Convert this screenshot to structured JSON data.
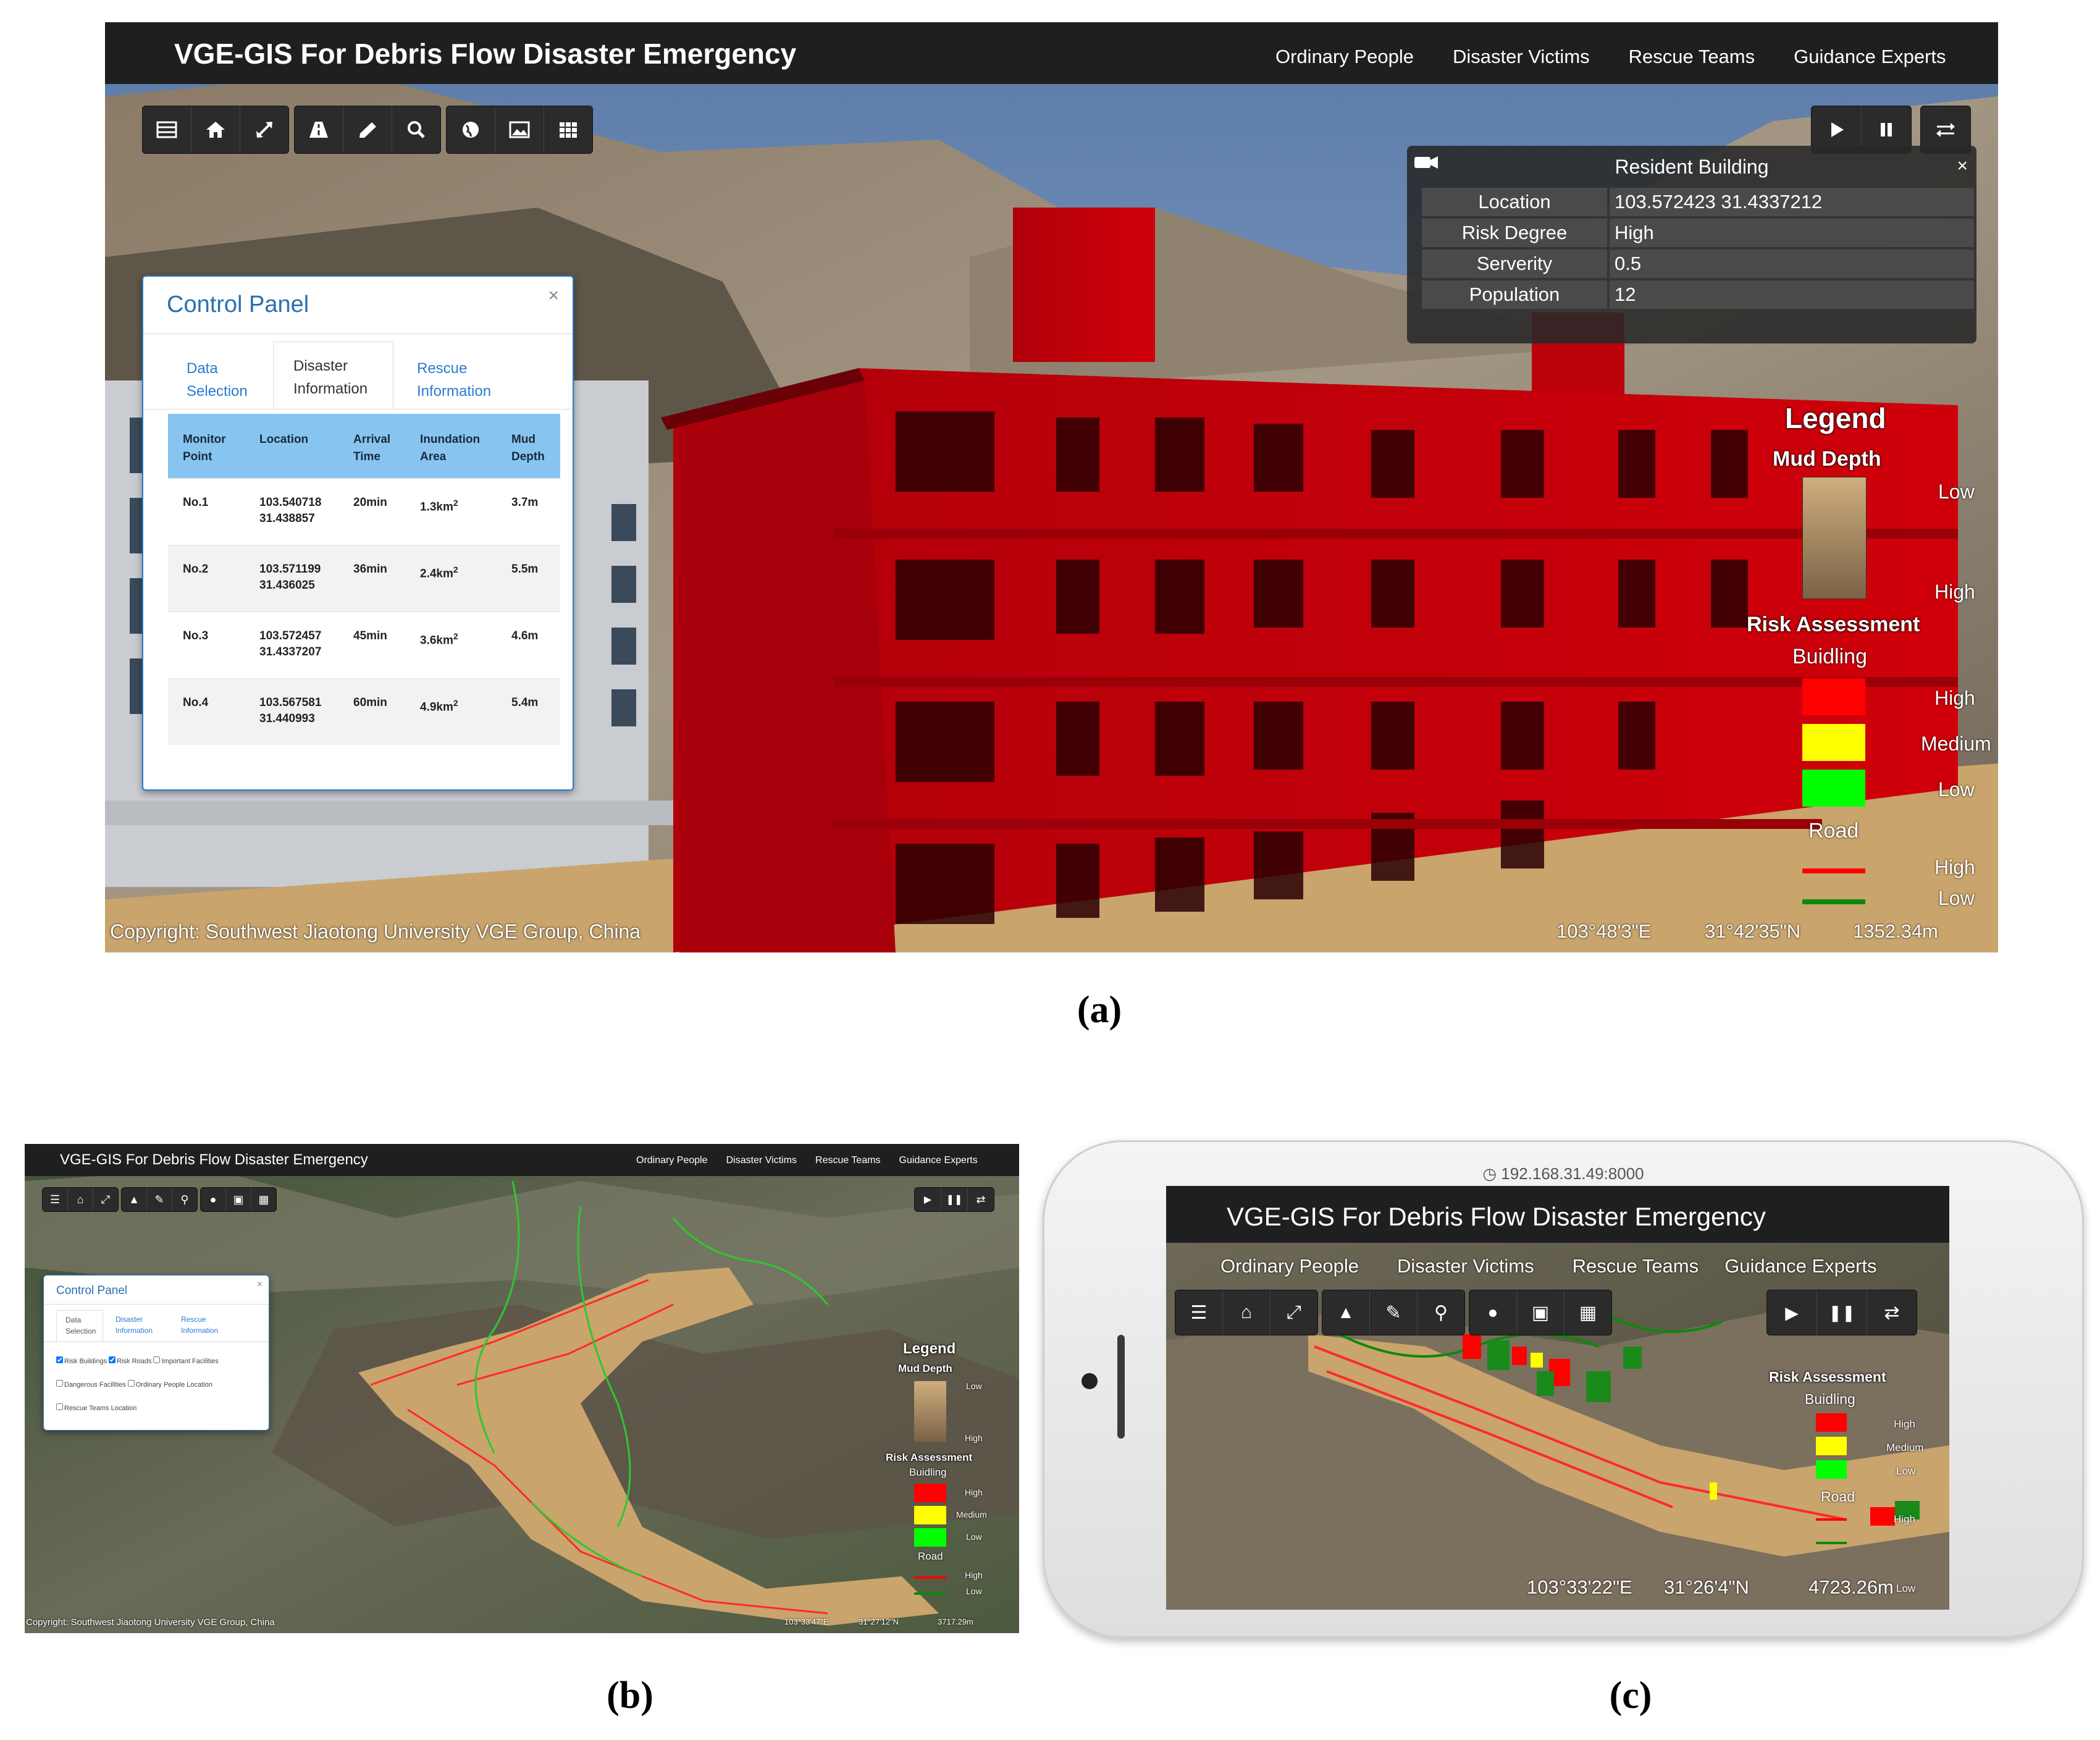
{
  "captions": {
    "a": "(a)",
    "b": "(b)",
    "c": "(c)"
  },
  "app": {
    "title": "VGE-GIS For Debris Flow Disaster Emergency",
    "nav": [
      "Ordinary People",
      "Disaster Victims",
      "Rescue Teams",
      "Guidance Experts"
    ],
    "toolbar_icons": [
      "list-icon",
      "home-icon",
      "fullscreen-icon",
      "road-icon",
      "pencil-icon",
      "search-icon",
      "globe-icon",
      "image-icon",
      "grid-icon"
    ],
    "playback_icons": [
      "play-icon",
      "pause-icon",
      "swap-icon"
    ],
    "copyright": "Copyright: Southwest Jiaotong University VGE Group, China"
  },
  "panel_a": {
    "control_panel": {
      "title": "Control Panel",
      "close": "×",
      "tabs": [
        {
          "line1": "Data",
          "line2": "Selection"
        },
        {
          "line1": "Disaster",
          "line2": "Information"
        },
        {
          "line1": "Rescue",
          "line2": "Information"
        }
      ],
      "columns": [
        {
          "line1": "Monitor",
          "line2": "Point"
        },
        {
          "line1": "",
          "line2": "Location"
        },
        {
          "line1": "Arrival",
          "line2": "Time"
        },
        {
          "line1": "Inundation",
          "line2": "Area"
        },
        {
          "line1": "Mud",
          "line2": "Depth"
        }
      ],
      "rows": [
        {
          "point": "No.1",
          "lon": "103.540718",
          "lat": "31.438857",
          "time": "20min",
          "area": "1.3km",
          "depth": "3.7m"
        },
        {
          "point": "No.2",
          "lon": "103.571199",
          "lat": "31.436025",
          "time": "36min",
          "area": "2.4km",
          "depth": "5.5m"
        },
        {
          "point": "No.3",
          "lon": "103.572457",
          "lat": "31.4337207",
          "time": "45min",
          "area": "3.6km",
          "depth": "4.6m"
        },
        {
          "point": "No.4",
          "lon": "103.567581",
          "lat": "31.440993",
          "time": "60min",
          "area": "4.9km",
          "depth": "5.4m"
        }
      ],
      "area_sup": "2"
    },
    "info_popup": {
      "title": "Resident Building",
      "close": "×",
      "rows": [
        {
          "key": "Location",
          "value": "103.572423 31.4337212"
        },
        {
          "key": "Risk Degree",
          "value": "High"
        },
        {
          "key": "Serverity",
          "value": "0.5"
        },
        {
          "key": "Population",
          "value": "12"
        }
      ]
    },
    "legend": {
      "title": "Legend",
      "mud_depth": "Mud Depth",
      "mud_low": "Low",
      "mud_high": "High",
      "risk": "Risk Assessment",
      "building": "Buidling",
      "b_high": "High",
      "b_medium": "Medium",
      "b_low": "Low",
      "road": "Road",
      "r_high": "High",
      "r_low": "Low"
    },
    "status": {
      "lon": "103°48'3\"E",
      "lat": "31°42'35\"N",
      "height": "1352.34m"
    }
  },
  "panel_b": {
    "control_panel": {
      "title": "Control Panel",
      "close": "×",
      "tabs": [
        {
          "line1": "Data",
          "line2": "Selection"
        },
        {
          "line1": "Disaster",
          "line2": "Information"
        },
        {
          "line1": "Rescue",
          "line2": "Information"
        }
      ],
      "checkboxes": [
        "Risk Buildings",
        "Risk Roads",
        "Important Facilities",
        "Dangerous Facilities",
        "Ordinary People Location",
        "Rescue Teams Location"
      ],
      "checked": [
        true,
        true,
        false,
        false,
        false,
        false
      ]
    },
    "legend": {
      "title": "Legend",
      "mud_depth": "Mud Depth",
      "mud_low": "Low",
      "mud_high": "High",
      "risk": "Risk Assessment",
      "building": "Buidling",
      "b_high": "High",
      "b_medium": "Medium",
      "b_low": "Low",
      "road": "Road",
      "r_high": "High",
      "r_low": "Low"
    },
    "status": {
      "lon": "103°33'47\"E",
      "lat": "31°27'12\"N",
      "height": "3717.29m"
    }
  },
  "panel_c": {
    "url": "192.168.31.49:8000",
    "legend": {
      "risk": "Risk Assessment",
      "building": "Buidling",
      "b_high": "High",
      "b_medium": "Medium",
      "b_low": "Low",
      "road": "Road",
      "r_high": "High",
      "r_low": "Low"
    },
    "status": {
      "lon": "103°33'22\"E",
      "lat": "31°26'4\"N",
      "height": "4723.26m"
    }
  },
  "colors": {
    "titlebar": "#1f1f1f",
    "building_red": "#c4000a",
    "mud": "#c9a46c",
    "risk_high": "#ff0000",
    "risk_medium": "#ffff00",
    "risk_low": "#00ff00",
    "road_low": "#0a8a0a",
    "table_header": "#87c5f0",
    "link": "#2a7bd0"
  }
}
